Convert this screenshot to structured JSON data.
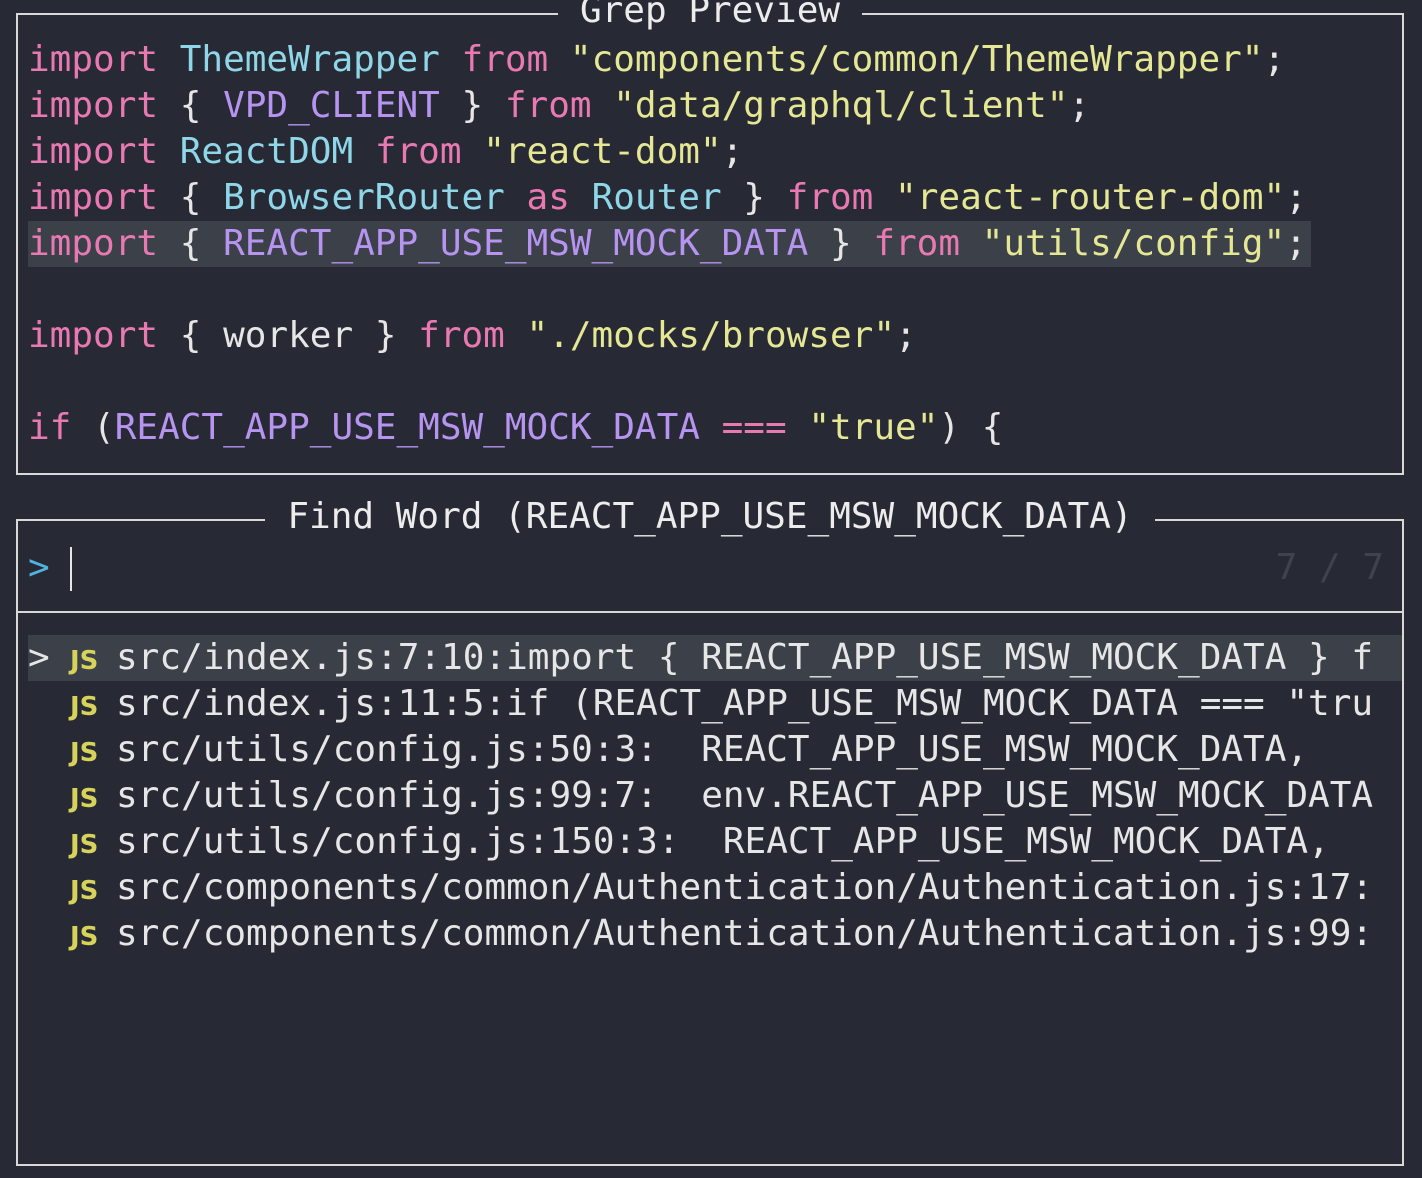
{
  "preview": {
    "title": "Grep Preview",
    "lines": [
      {
        "tokens": [
          [
            "kw",
            "import"
          ],
          [
            "pl",
            " "
          ],
          [
            "id",
            "ThemeWrapper"
          ],
          [
            "pl",
            " "
          ],
          [
            "kw",
            "from"
          ],
          [
            "pl",
            " "
          ],
          [
            "st",
            "\"components/common/ThemeWrapper\""
          ],
          [
            "pl",
            ";"
          ]
        ]
      },
      {
        "tokens": [
          [
            "kw",
            "import"
          ],
          [
            "pl",
            " { "
          ],
          [
            "cs",
            "VPD_CLIENT"
          ],
          [
            "pl",
            " } "
          ],
          [
            "kw",
            "from"
          ],
          [
            "pl",
            " "
          ],
          [
            "st",
            "\"data/graphql/client\""
          ],
          [
            "pl",
            ";"
          ]
        ]
      },
      {
        "tokens": [
          [
            "kw",
            "import"
          ],
          [
            "pl",
            " "
          ],
          [
            "id",
            "ReactDOM"
          ],
          [
            "pl",
            " "
          ],
          [
            "kw",
            "from"
          ],
          [
            "pl",
            " "
          ],
          [
            "st",
            "\"react-dom\""
          ],
          [
            "pl",
            ";"
          ]
        ]
      },
      {
        "tokens": [
          [
            "kw",
            "import"
          ],
          [
            "pl",
            " { "
          ],
          [
            "id",
            "BrowserRouter"
          ],
          [
            "pl",
            " "
          ],
          [
            "kw",
            "as"
          ],
          [
            "pl",
            " "
          ],
          [
            "id",
            "Router"
          ],
          [
            "pl",
            " } "
          ],
          [
            "kw",
            "from"
          ],
          [
            "pl",
            " "
          ],
          [
            "st",
            "\"react-router-dom\""
          ],
          [
            "pl",
            ";"
          ]
        ]
      },
      {
        "highlight": true,
        "tokens": [
          [
            "kw",
            "import"
          ],
          [
            "pl",
            " { "
          ],
          [
            "cs",
            "REACT_APP_USE_MSW_MOCK_DATA"
          ],
          [
            "pl",
            " } "
          ],
          [
            "kw",
            "from"
          ],
          [
            "pl",
            " "
          ],
          [
            "st",
            "\"utils/config\""
          ],
          [
            "pl",
            ";"
          ]
        ]
      },
      {
        "tokens": []
      },
      {
        "tokens": [
          [
            "kw",
            "import"
          ],
          [
            "pl",
            " { worker } "
          ],
          [
            "kw",
            "from"
          ],
          [
            "pl",
            " "
          ],
          [
            "st",
            "\"./mocks/browser\""
          ],
          [
            "pl",
            ";"
          ]
        ]
      },
      {
        "tokens": []
      },
      {
        "tokens": [
          [
            "kw",
            "if"
          ],
          [
            "pl",
            " ("
          ],
          [
            "cs",
            "REACT_APP_USE_MSW_MOCK_DATA"
          ],
          [
            "pl",
            " "
          ],
          [
            "kw",
            "==="
          ],
          [
            "pl",
            " "
          ],
          [
            "st",
            "\"true\""
          ],
          [
            "pl",
            ") {"
          ]
        ]
      }
    ]
  },
  "finder": {
    "title": "Find Word (REACT_APP_USE_MSW_MOCK_DATA)",
    "prompt": ">",
    "query": "",
    "count": "7 / 7",
    "selected_marker": ">",
    "file_icon": "JS",
    "results": [
      {
        "text": "src/index.js:7:10:import { REACT_APP_USE_MSW_MOCK_DATA } f",
        "selected": true
      },
      {
        "text": "src/index.js:11:5:if (REACT_APP_USE_MSW_MOCK_DATA === \"tru"
      },
      {
        "text": "src/utils/config.js:50:3:  REACT_APP_USE_MSW_MOCK_DATA,"
      },
      {
        "text": "src/utils/config.js:99:7:  env.REACT_APP_USE_MSW_MOCK_DATA"
      },
      {
        "text": "src/utils/config.js:150:3:  REACT_APP_USE_MSW_MOCK_DATA,"
      },
      {
        "text": "src/components/common/Authentication/Authentication.js:17:"
      },
      {
        "text": "src/components/common/Authentication/Authentication.js:99:"
      }
    ]
  },
  "colors": {
    "background": "#272a34",
    "keyword": "#e879b3",
    "identifier": "#8fd6e8",
    "constant": "#b694f0",
    "string": "#e5e794",
    "selection": "#3b4049",
    "js_icon": "#d6d25a",
    "prompt": "#4fb4e0"
  }
}
